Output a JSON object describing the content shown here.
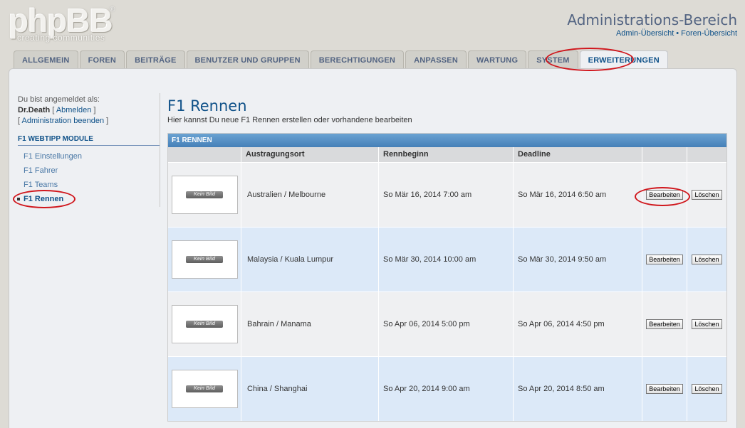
{
  "logo": {
    "text": "phpBB",
    "reg": "®",
    "tagline": "creating communities"
  },
  "header": {
    "title": "Administrations-Bereich",
    "links": [
      "Admin-Übersicht",
      "Foren-Übersicht"
    ],
    "separator": "•"
  },
  "tabs": [
    {
      "label": "Allgemein"
    },
    {
      "label": "Foren"
    },
    {
      "label": "Beiträge"
    },
    {
      "label": "Benutzer und Gruppen"
    },
    {
      "label": "Berechtigungen"
    },
    {
      "label": "Anpassen"
    },
    {
      "label": "Wartung"
    },
    {
      "label": "System"
    },
    {
      "label": "Erweiterungen",
      "active": true
    }
  ],
  "sidebar": {
    "logged_in_as": "Du bist angemeldet als:",
    "username": "Dr.Death",
    "logout": "Abmelden",
    "end_admin": "Administration beenden",
    "module_heading": "F1 Webtipp Module",
    "items": [
      {
        "label": "F1 Einstellungen"
      },
      {
        "label": "F1 Fahrer"
      },
      {
        "label": "F1 Teams"
      },
      {
        "label": "F1 Rennen",
        "active": true
      }
    ]
  },
  "main": {
    "title": "F1 Rennen",
    "description": "Hier kannst Du neue F1 Rennen erstellen oder vorhandene bearbeiten",
    "table_caption": "F1 Rennen",
    "columns": [
      "",
      "Austragungsort",
      "Rennbeginn",
      "Deadline",
      "",
      ""
    ],
    "image_placeholder": "Kein Bild",
    "edit_label": "Bearbeiten",
    "delete_label": "Löschen",
    "rows": [
      {
        "location": "Australien / Melbourne",
        "start": "So Mär 16, 2014 7:00 am",
        "deadline": "So Mär 16, 2014 6:50 am"
      },
      {
        "location": "Malaysia / Kuala Lumpur",
        "start": "So Mär 30, 2014 10:00 am",
        "deadline": "So Mär 30, 2014 9:50 am"
      },
      {
        "location": "Bahrain / Manama",
        "start": "So Apr 06, 2014 5:00 pm",
        "deadline": "So Apr 06, 2014 4:50 pm"
      },
      {
        "location": "China / Shanghai",
        "start": "So Apr 20, 2014 9:00 am",
        "deadline": "So Apr 20, 2014 8:50 am"
      }
    ]
  },
  "colors": {
    "accent": "#105289",
    "highlight_ring": "#d0161c",
    "table_caption": "#4580b8"
  }
}
